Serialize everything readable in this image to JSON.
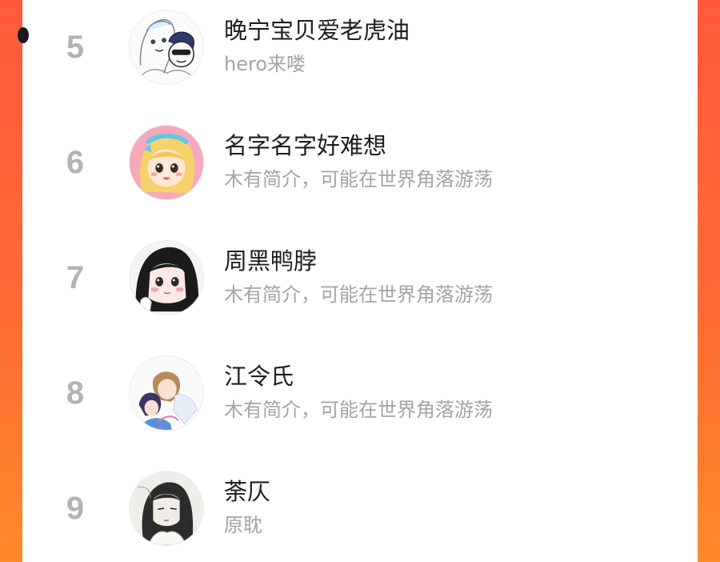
{
  "ranking": {
    "items": [
      {
        "rank": "5",
        "name": "晚宁宝贝爱老虎油",
        "bio": "hero来喽",
        "avatar_icon": "anime-duo-sketch-avatar-icon"
      },
      {
        "rank": "6",
        "name": "名字名字好难想",
        "bio": "木有简介，可能在世界角落游荡",
        "avatar_icon": "anime-blonde-girl-avatar-icon"
      },
      {
        "rank": "7",
        "name": "周黑鸭脖",
        "bio": "木有简介，可能在世界角落游荡",
        "avatar_icon": "anime-black-hair-girl-avatar-icon"
      },
      {
        "rank": "8",
        "name": "江令氏",
        "bio": "木有简介，可能在世界角落游荡",
        "avatar_icon": "anime-couple-avatar-icon"
      },
      {
        "rank": "9",
        "name": "荼仄",
        "bio": "原耽",
        "avatar_icon": "anime-long-hair-man-avatar-icon"
      }
    ]
  },
  "colors": {
    "background_gradient_top": "#ff5a3c",
    "background_gradient_bottom": "#ff8a2a",
    "panel": "#ffffff",
    "rank_text": "#b3b3b3",
    "name_text": "#1e1e1e",
    "bio_text": "#a4a4a4"
  }
}
